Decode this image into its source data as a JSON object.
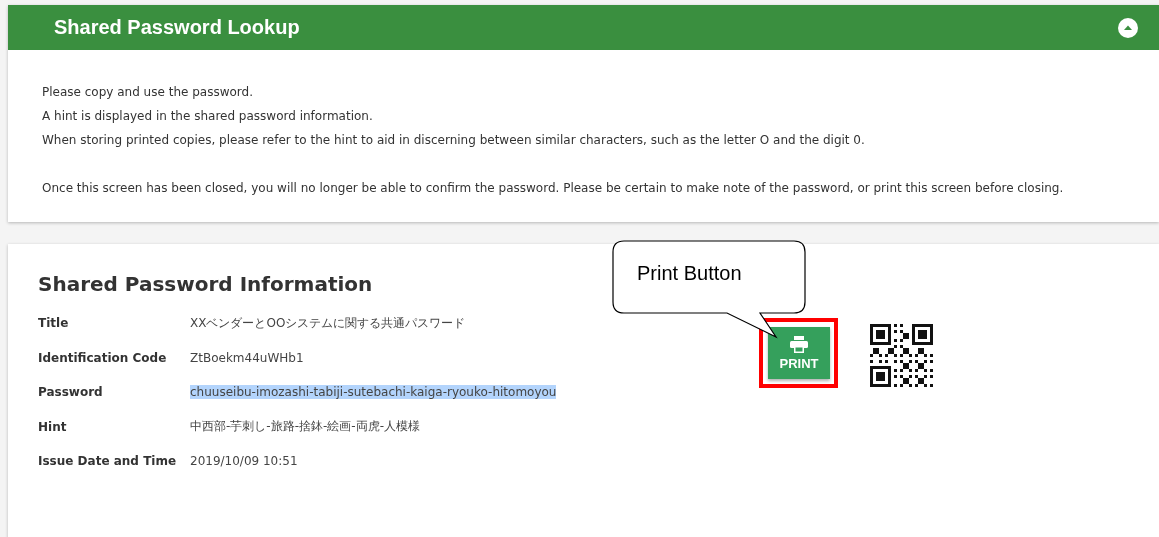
{
  "lookup_panel": {
    "title": "Shared Password Lookup",
    "expanded": true,
    "paragraphs": [
      "Please copy and use the password.",
      "A hint is displayed in the shared password information.",
      "When storing printed copies, please refer to the hint to aid in discerning between similar characters, such as the letter O and the digit 0.",
      "Once this screen has been closed, you will no longer be able to confirm the password. Please be certain to make note of the password, or print this screen before closing."
    ]
  },
  "info_panel": {
    "title": "Shared Password Information",
    "fields": [
      {
        "label": "Title",
        "value": "XXベンダーとOOシステムに関する共通パスワード",
        "highlighted": false
      },
      {
        "label": "Identification Code",
        "value": "ZtBoekm44uWHb1",
        "highlighted": false
      },
      {
        "label": "Password",
        "value": "chuuseibu-imozashi-tabiji-sutebachi-kaiga-ryouko-hitomoyou",
        "highlighted": true
      },
      {
        "label": "Hint",
        "value": "中西部-芋刺し-旅路-捨鉢-絵画-両虎-人模様",
        "highlighted": false
      },
      {
        "label": "Issue Date and Time",
        "value": "2019/10/09 10:51",
        "highlighted": false
      }
    ],
    "print_button": {
      "label": "PRINT"
    }
  },
  "callout": {
    "text": "Print Button"
  }
}
